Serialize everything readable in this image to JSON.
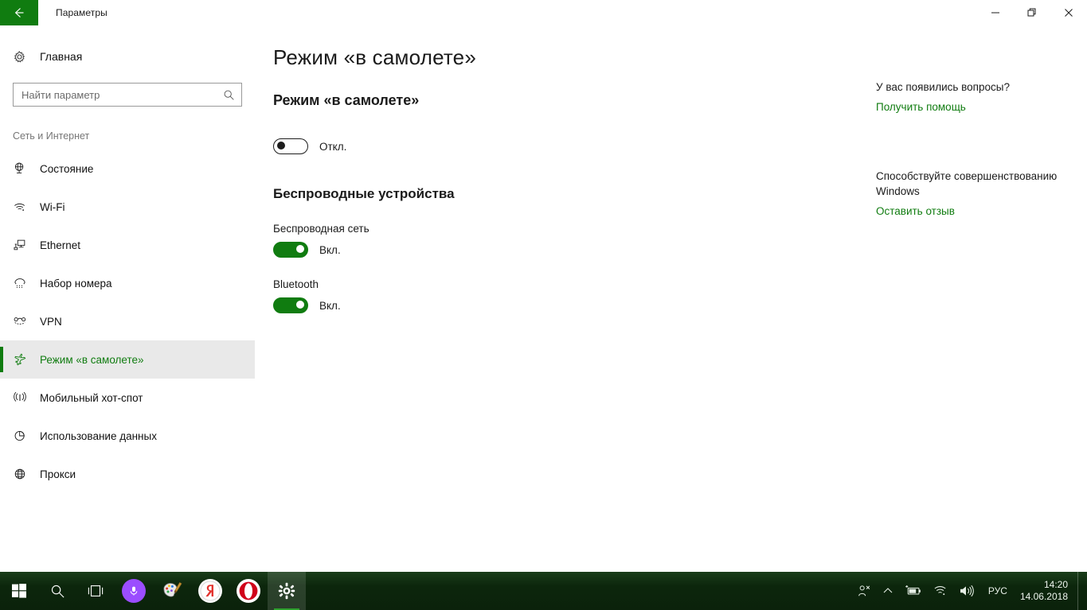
{
  "window": {
    "title": "Параметры",
    "back_icon": "back-arrow-icon",
    "minimize_label": "Свернуть",
    "restore_label": "Развернуть",
    "close_label": "Закрыть"
  },
  "sidebar": {
    "home": {
      "label": "Главная",
      "icon": "gear-icon"
    },
    "search": {
      "placeholder": "Найти параметр",
      "value": "",
      "icon": "search-icon"
    },
    "group_title": "Сеть и Интернет",
    "items": [
      {
        "label": "Состояние",
        "icon": "status-globe-icon",
        "selected": false
      },
      {
        "label": "Wi-Fi",
        "icon": "wifi-icon",
        "selected": false
      },
      {
        "label": "Ethernet",
        "icon": "ethernet-icon",
        "selected": false
      },
      {
        "label": "Набор номера",
        "icon": "dialup-icon",
        "selected": false
      },
      {
        "label": "VPN",
        "icon": "vpn-icon",
        "selected": false
      },
      {
        "label": "Режим «в самолете»",
        "icon": "airplane-icon",
        "selected": true
      },
      {
        "label": "Мобильный хот-спот",
        "icon": "hotspot-icon",
        "selected": false
      },
      {
        "label": "Использование данных",
        "icon": "data-usage-icon",
        "selected": false
      },
      {
        "label": "Прокси",
        "icon": "proxy-globe-icon",
        "selected": false
      }
    ]
  },
  "main": {
    "page_title": "Режим «в самолете»",
    "airplane_section": {
      "heading": "Режим «в самолете»",
      "toggle_state": "Откл.",
      "toggle_on": false
    },
    "wireless_section": {
      "heading": "Беспроводные устройства",
      "devices": [
        {
          "label": "Беспроводная сеть",
          "toggle_state": "Вкл.",
          "toggle_on": true
        },
        {
          "label": "Bluetooth",
          "toggle_state": "Вкл.",
          "toggle_on": true
        }
      ]
    }
  },
  "aside": {
    "help_heading": "У вас появились вопросы?",
    "help_link": "Получить помощь",
    "feedback_heading": "Способствуйте совершенствованию Windows",
    "feedback_link": "Оставить отзыв"
  },
  "taskbar": {
    "start": "start-icon",
    "search": "search-icon",
    "task_view": "task-view-icon",
    "apps": [
      {
        "name": "cortana-icon",
        "color": "#9b4dff"
      },
      {
        "name": "paint-icon",
        "color": "#f2f2f2"
      },
      {
        "name": "yandex-browser-icon",
        "color": "#ffffff",
        "glyph": "Y"
      },
      {
        "name": "opera-icon",
        "color": "#ffffff",
        "glyph": "O"
      },
      {
        "name": "settings-icon",
        "color": "#ffffff",
        "active": true
      }
    ],
    "tray": {
      "people": "people-icon",
      "show_hidden": "chevron-up-icon",
      "battery": "battery-charging-icon",
      "network": "wifi-icon",
      "volume": "speaker-icon",
      "language": "РУС"
    },
    "clock": {
      "time": "14:20",
      "date": "14.06.2018"
    }
  },
  "colors": {
    "accent_green": "#107C10",
    "link_green": "#107C10",
    "selected_row_bg": "#e9e9e9",
    "taskbar_bg": "#0c260c"
  }
}
